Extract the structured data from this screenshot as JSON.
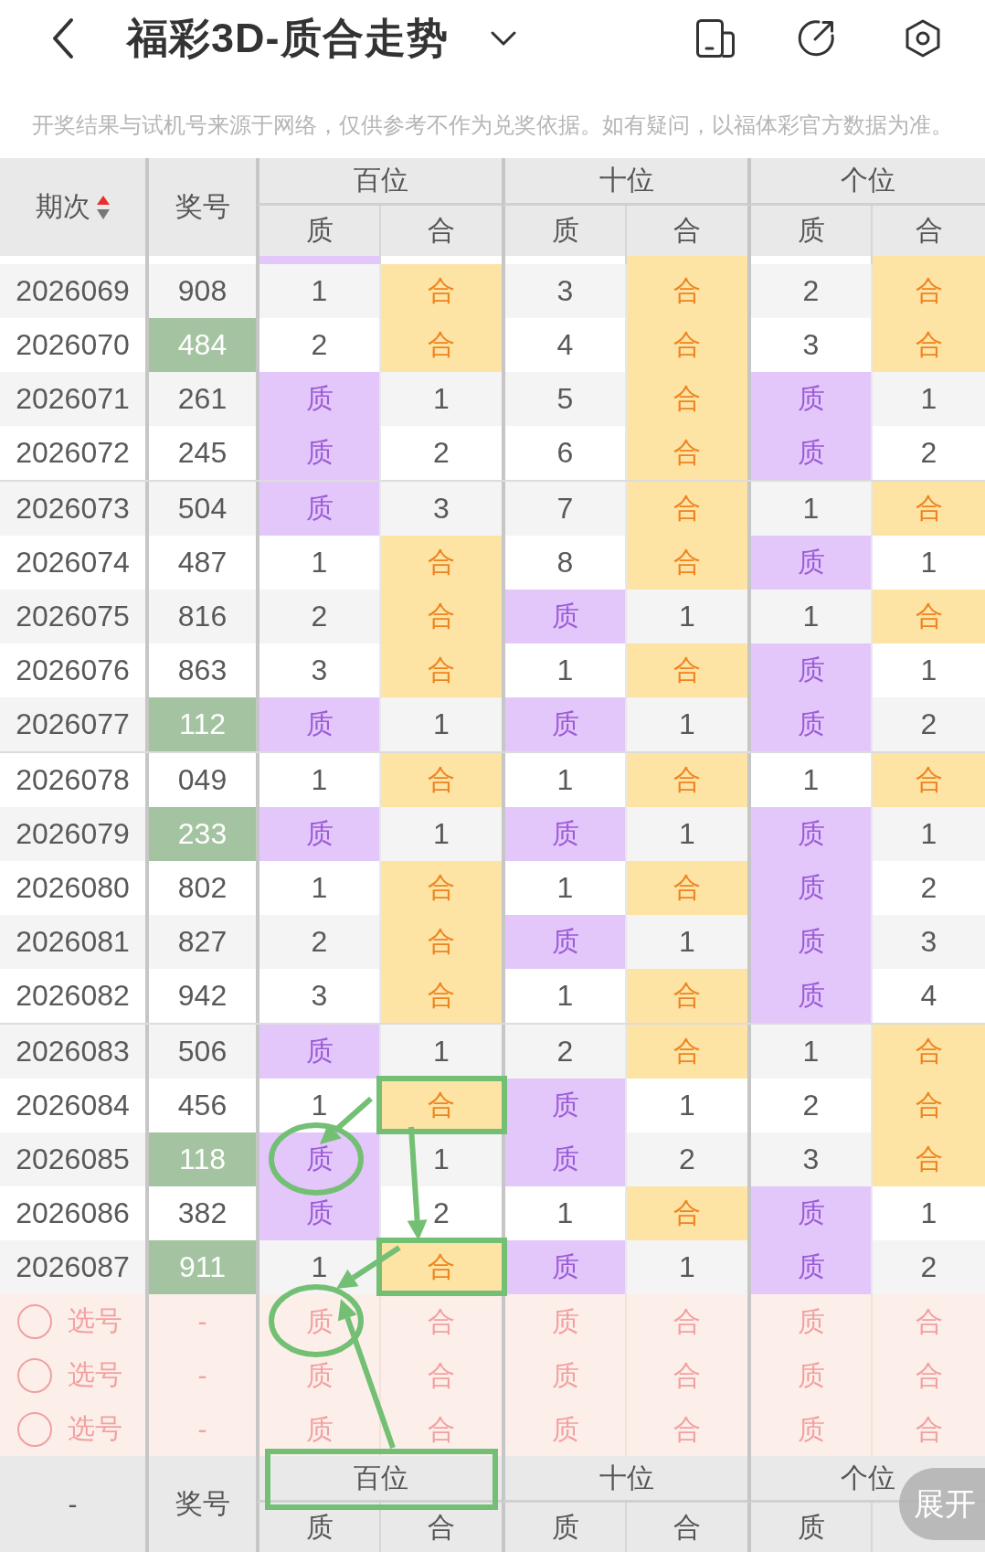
{
  "top_bar": {
    "title": "福彩3D-质合走势"
  },
  "notice": "开奖结果与试机号来源于网络，仅供参考不作为兑奖依据。如有疑问，以福体彩官方数据为准。",
  "table": {
    "header": {
      "period": "期次",
      "sorted_ascending": true,
      "number": "奖号",
      "groups": [
        {
          "label": "百位",
          "columns": [
            {
              "label": "质",
              "kind": "prime"
            },
            {
              "label": "合",
              "kind": "composite"
            }
          ]
        },
        {
          "label": "十位",
          "columns": [
            {
              "label": "质",
              "kind": "prime"
            },
            {
              "label": "合",
              "kind": "composite"
            }
          ]
        },
        {
          "label": "个位",
          "columns": [
            {
              "label": "质",
              "kind": "prime"
            },
            {
              "label": "合",
              "kind": "composite"
            }
          ]
        }
      ]
    },
    "cut_row": {
      "cells": [
        {
          "hit": true
        },
        {
          "hit": false
        },
        {
          "hit": false
        },
        {
          "hit": true
        },
        {
          "hit": false
        },
        {
          "hit": true
        }
      ]
    },
    "row_groups": [
      {
        "rows": [
          {
            "period": "2026069",
            "number": "908",
            "highlight": false,
            "cells": [
              {
                "text": "1",
                "hit": false,
                "kind": "plain"
              },
              {
                "text": "合",
                "hit": true,
                "kind": "plain"
              },
              {
                "text": "3",
                "hit": false,
                "kind": "plain"
              },
              {
                "text": "合",
                "hit": true,
                "kind": "plain"
              },
              {
                "text": "2",
                "hit": false,
                "kind": "plain"
              },
              {
                "text": "合",
                "hit": true,
                "kind": "plain"
              }
            ]
          },
          {
            "period": "2026070",
            "number": "484",
            "highlight": true,
            "cells": [
              {
                "text": "2",
                "hit": false,
                "kind": "plain"
              },
              {
                "text": "合",
                "hit": true,
                "kind": "plain"
              },
              {
                "text": "4",
                "hit": false,
                "kind": "plain"
              },
              {
                "text": "合",
                "hit": true,
                "kind": "plain"
              },
              {
                "text": "3",
                "hit": false,
                "kind": "plain"
              },
              {
                "text": "合",
                "hit": true,
                "kind": "plain"
              }
            ]
          },
          {
            "period": "2026071",
            "number": "261",
            "highlight": false,
            "cells": [
              {
                "text": "质",
                "hit": true,
                "kind": "plain"
              },
              {
                "text": "1",
                "hit": false,
                "kind": "plain"
              },
              {
                "text": "5",
                "hit": false,
                "kind": "plain"
              },
              {
                "text": "合",
                "hit": true,
                "kind": "plain"
              },
              {
                "text": "质",
                "hit": true,
                "kind": "plain"
              },
              {
                "text": "1",
                "hit": false,
                "kind": "plain"
              }
            ]
          },
          {
            "period": "2026072",
            "number": "245",
            "highlight": false,
            "cells": [
              {
                "text": "质",
                "hit": true,
                "kind": "plain"
              },
              {
                "text": "2",
                "hit": false,
                "kind": "plain"
              },
              {
                "text": "6",
                "hit": false,
                "kind": "plain"
              },
              {
                "text": "合",
                "hit": true,
                "kind": "plain"
              },
              {
                "text": "质",
                "hit": true,
                "kind": "plain"
              },
              {
                "text": "2",
                "hit": false,
                "kind": "plain"
              }
            ]
          }
        ]
      },
      {
        "rows": [
          {
            "period": "2026073",
            "number": "504",
            "highlight": false,
            "cells": [
              {
                "text": "质",
                "hit": true,
                "kind": "plain"
              },
              {
                "text": "3",
                "hit": false,
                "kind": "plain"
              },
              {
                "text": "7",
                "hit": false,
                "kind": "plain"
              },
              {
                "text": "合",
                "hit": true,
                "kind": "plain"
              },
              {
                "text": "1",
                "hit": false,
                "kind": "plain"
              },
              {
                "text": "合",
                "hit": true,
                "kind": "plain"
              }
            ]
          },
          {
            "period": "2026074",
            "number": "487",
            "highlight": false,
            "cells": [
              {
                "text": "1",
                "hit": false,
                "kind": "plain"
              },
              {
                "text": "合",
                "hit": true,
                "kind": "plain"
              },
              {
                "text": "8",
                "hit": false,
                "kind": "plain"
              },
              {
                "text": "合",
                "hit": true,
                "kind": "plain"
              },
              {
                "text": "质",
                "hit": true,
                "kind": "plain"
              },
              {
                "text": "1",
                "hit": false,
                "kind": "plain"
              }
            ]
          },
          {
            "period": "2026075",
            "number": "816",
            "highlight": false,
            "cells": [
              {
                "text": "2",
                "hit": false,
                "kind": "plain"
              },
              {
                "text": "合",
                "hit": true,
                "kind": "plain"
              },
              {
                "text": "质",
                "hit": true,
                "kind": "plain"
              },
              {
                "text": "1",
                "hit": false,
                "kind": "plain"
              },
              {
                "text": "1",
                "hit": false,
                "kind": "plain"
              },
              {
                "text": "合",
                "hit": true,
                "kind": "plain"
              }
            ]
          },
          {
            "period": "2026076",
            "number": "863",
            "highlight": false,
            "cells": [
              {
                "text": "3",
                "hit": false,
                "kind": "plain"
              },
              {
                "text": "合",
                "hit": true,
                "kind": "plain"
              },
              {
                "text": "1",
                "hit": false,
                "kind": "plain"
              },
              {
                "text": "合",
                "hit": true,
                "kind": "plain"
              },
              {
                "text": "质",
                "hit": true,
                "kind": "plain"
              },
              {
                "text": "1",
                "hit": false,
                "kind": "plain"
              }
            ]
          },
          {
            "period": "2026077",
            "number": "112",
            "highlight": true,
            "cells": [
              {
                "text": "质",
                "hit": true,
                "kind": "plain"
              },
              {
                "text": "1",
                "hit": false,
                "kind": "plain"
              },
              {
                "text": "质",
                "hit": true,
                "kind": "plain"
              },
              {
                "text": "1",
                "hit": false,
                "kind": "plain"
              },
              {
                "text": "质",
                "hit": true,
                "kind": "plain"
              },
              {
                "text": "2",
                "hit": false,
                "kind": "plain"
              }
            ]
          }
        ]
      },
      {
        "rows": [
          {
            "period": "2026078",
            "number": "049",
            "highlight": false,
            "cells": [
              {
                "text": "1",
                "hit": false,
                "kind": "plain"
              },
              {
                "text": "合",
                "hit": true,
                "kind": "plain"
              },
              {
                "text": "1",
                "hit": false,
                "kind": "plain"
              },
              {
                "text": "合",
                "hit": true,
                "kind": "plain"
              },
              {
                "text": "1",
                "hit": false,
                "kind": "plain"
              },
              {
                "text": "合",
                "hit": true,
                "kind": "plain"
              }
            ]
          },
          {
            "period": "2026079",
            "number": "233",
            "highlight": true,
            "cells": [
              {
                "text": "质",
                "hit": true,
                "kind": "plain"
              },
              {
                "text": "1",
                "hit": false,
                "kind": "plain"
              },
              {
                "text": "质",
                "hit": true,
                "kind": "plain"
              },
              {
                "text": "1",
                "hit": false,
                "kind": "plain"
              },
              {
                "text": "质",
                "hit": true,
                "kind": "plain"
              },
              {
                "text": "1",
                "hit": false,
                "kind": "plain"
              }
            ]
          },
          {
            "period": "2026080",
            "number": "802",
            "highlight": false,
            "cells": [
              {
                "text": "1",
                "hit": false,
                "kind": "plain"
              },
              {
                "text": "合",
                "hit": true,
                "kind": "plain"
              },
              {
                "text": "1",
                "hit": false,
                "kind": "plain"
              },
              {
                "text": "合",
                "hit": true,
                "kind": "plain"
              },
              {
                "text": "质",
                "hit": true,
                "kind": "plain"
              },
              {
                "text": "2",
                "hit": false,
                "kind": "plain"
              }
            ]
          },
          {
            "period": "2026081",
            "number": "827",
            "highlight": false,
            "cells": [
              {
                "text": "2",
                "hit": false,
                "kind": "plain"
              },
              {
                "text": "合",
                "hit": true,
                "kind": "plain"
              },
              {
                "text": "质",
                "hit": true,
                "kind": "plain"
              },
              {
                "text": "1",
                "hit": false,
                "kind": "plain"
              },
              {
                "text": "质",
                "hit": true,
                "kind": "plain"
              },
              {
                "text": "3",
                "hit": false,
                "kind": "plain"
              }
            ]
          },
          {
            "period": "2026082",
            "number": "942",
            "highlight": false,
            "cells": [
              {
                "text": "3",
                "hit": false,
                "kind": "plain"
              },
              {
                "text": "合",
                "hit": true,
                "kind": "plain"
              },
              {
                "text": "1",
                "hit": false,
                "kind": "plain"
              },
              {
                "text": "合",
                "hit": true,
                "kind": "plain"
              },
              {
                "text": "质",
                "hit": true,
                "kind": "plain"
              },
              {
                "text": "4",
                "hit": false,
                "kind": "plain"
              }
            ]
          }
        ]
      },
      {
        "rows": [
          {
            "period": "2026083",
            "number": "506",
            "highlight": false,
            "cells": [
              {
                "text": "质",
                "hit": true,
                "kind": "plain"
              },
              {
                "text": "1",
                "hit": false,
                "kind": "plain"
              },
              {
                "text": "2",
                "hit": false,
                "kind": "plain"
              },
              {
                "text": "合",
                "hit": true,
                "kind": "plain"
              },
              {
                "text": "1",
                "hit": false,
                "kind": "plain"
              },
              {
                "text": "合",
                "hit": true,
                "kind": "plain"
              }
            ]
          },
          {
            "period": "2026084",
            "number": "456",
            "highlight": false,
            "cells": [
              {
                "text": "1",
                "hit": false,
                "kind": "plain"
              },
              {
                "text": "合",
                "hit": true,
                "kind": "boxed"
              },
              {
                "text": "质",
                "hit": true,
                "kind": "plain"
              },
              {
                "text": "1",
                "hit": false,
                "kind": "plain"
              },
              {
                "text": "2",
                "hit": false,
                "kind": "plain"
              },
              {
                "text": "合",
                "hit": true,
                "kind": "plain"
              }
            ]
          },
          {
            "period": "2026085",
            "number": "118",
            "highlight": true,
            "cells": [
              {
                "text": "质",
                "hit": true,
                "kind": "circled"
              },
              {
                "text": "1",
                "hit": false,
                "kind": "plain"
              },
              {
                "text": "质",
                "hit": true,
                "kind": "plain"
              },
              {
                "text": "2",
                "hit": false,
                "kind": "plain"
              },
              {
                "text": "3",
                "hit": false,
                "kind": "plain"
              },
              {
                "text": "合",
                "hit": true,
                "kind": "plain"
              }
            ]
          },
          {
            "period": "2026086",
            "number": "382",
            "highlight": false,
            "cells": [
              {
                "text": "质",
                "hit": true,
                "kind": "plain"
              },
              {
                "text": "2",
                "hit": false,
                "kind": "plain"
              },
              {
                "text": "1",
                "hit": false,
                "kind": "plain"
              },
              {
                "text": "合",
                "hit": true,
                "kind": "plain"
              },
              {
                "text": "质",
                "hit": true,
                "kind": "plain"
              },
              {
                "text": "1",
                "hit": false,
                "kind": "plain"
              }
            ]
          },
          {
            "period": "2026087",
            "number": "911",
            "highlight": true,
            "cells": [
              {
                "text": "1",
                "hit": false,
                "kind": "plain"
              },
              {
                "text": "合",
                "hit": true,
                "kind": "boxed"
              },
              {
                "text": "质",
                "hit": true,
                "kind": "plain"
              },
              {
                "text": "1",
                "hit": false,
                "kind": "plain"
              },
              {
                "text": "质",
                "hit": true,
                "kind": "plain"
              },
              {
                "text": "2",
                "hit": false,
                "kind": "plain"
              }
            ]
          }
        ]
      }
    ],
    "pick_rows": [
      {
        "label": "选号",
        "checked": false,
        "number": "-",
        "cells": [
          {
            "text": "质",
            "selected": false,
            "kind": "circled"
          },
          {
            "text": "合",
            "selected": false,
            "kind": "plain"
          },
          {
            "text": "质",
            "selected": false,
            "kind": "plain"
          },
          {
            "text": "合",
            "selected": false,
            "kind": "plain"
          },
          {
            "text": "质",
            "selected": false,
            "kind": "plain"
          },
          {
            "text": "合",
            "selected": false,
            "kind": "plain"
          }
        ]
      },
      {
        "label": "选号",
        "checked": false,
        "number": "-",
        "cells": [
          {
            "text": "质",
            "selected": false,
            "kind": "plain"
          },
          {
            "text": "合",
            "selected": false,
            "kind": "plain"
          },
          {
            "text": "质",
            "selected": false,
            "kind": "plain"
          },
          {
            "text": "合",
            "selected": false,
            "kind": "plain"
          },
          {
            "text": "质",
            "selected": false,
            "kind": "plain"
          },
          {
            "text": "合",
            "selected": false,
            "kind": "plain"
          }
        ]
      },
      {
        "label": "选号",
        "checked": false,
        "number": "-",
        "cells": [
          {
            "text": "质",
            "selected": false,
            "kind": "plain"
          },
          {
            "text": "合",
            "selected": false,
            "kind": "plain"
          },
          {
            "text": "质",
            "selected": false,
            "kind": "plain"
          },
          {
            "text": "合",
            "selected": false,
            "kind": "plain"
          },
          {
            "text": "质",
            "selected": false,
            "kind": "plain"
          },
          {
            "text": "合",
            "selected": false,
            "kind": "plain"
          }
        ]
      }
    ],
    "footer": {
      "period": "-",
      "number": "奖号",
      "groups": [
        {
          "label": "百位",
          "kind": "boxed",
          "columns": [
            "质",
            "合"
          ]
        },
        {
          "label": "十位",
          "kind": "plain",
          "columns": [
            "质",
            "合"
          ]
        },
        {
          "label": "个位",
          "kind": "plain",
          "columns": [
            "质"
          ]
        }
      ]
    }
  },
  "expand_button": {
    "label": "展开"
  }
}
